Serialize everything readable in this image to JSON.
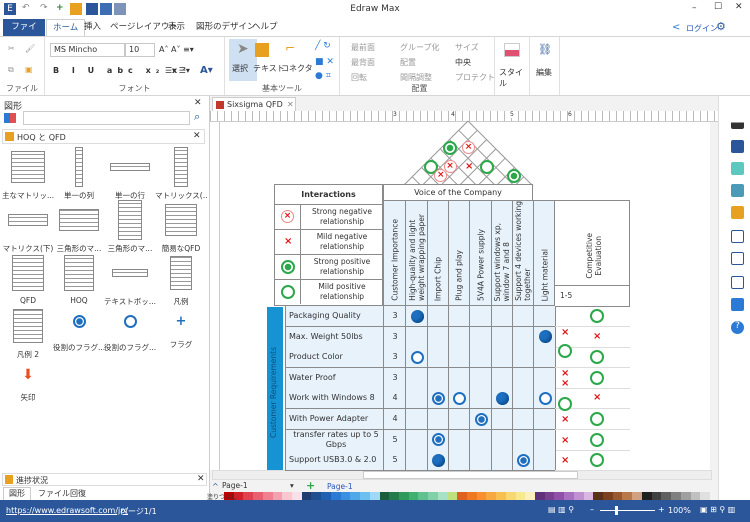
{
  "app": {
    "title": "Edraw Max",
    "login": "ログイン"
  },
  "tabs": [
    "ファイル",
    "ホーム",
    "挿入",
    "ページレイアウト",
    "表示",
    "図形のデザイン",
    "ヘルプ"
  ],
  "ribbon": {
    "font_name": "MS Mincho",
    "font_size": "10",
    "groups": {
      "file": "ファイル",
      "font": "フォント",
      "basic": "基本ツール",
      "arrange": "配置"
    },
    "tools": {
      "select": "選択",
      "text": "テキスト",
      "connector": "コネクタ"
    },
    "arrange_items": [
      "最前面",
      "グループ化",
      "サイズ",
      "最背面",
      "配置",
      "中央",
      "回転",
      "間隔調整",
      "プロテクト"
    ],
    "style": "スタイル",
    "edit": "編集"
  },
  "left": {
    "title": "図形",
    "library": "HOQ と QFD",
    "shapes": [
      "主なマトリッ...",
      "単一の列",
      "単一の行",
      "マトリックス(...",
      "マトリクス(下)",
      "三角形のマ...",
      "三角形のマ...",
      "簡易なQFD",
      "QFD",
      "HOQ",
      "テキストボッ...",
      "凡例",
      "凡例 2",
      "役割のフラグ...",
      "役割のフラグ...",
      "フラグ",
      "矢印"
    ],
    "bottom_title": "進捗状況",
    "bottom_tabs": [
      "図形",
      "ファイル回復"
    ]
  },
  "doc_tab": "Sixsigma QFD",
  "matrix": {
    "interactions_title": "Interactions",
    "legend": [
      "Strong negative relationship",
      "Mild negative relationship",
      "Strong positive relationship",
      "Mild positive relationship"
    ],
    "voice_title": "Voice of the Company",
    "columns": [
      "Customer Importance",
      "High-quality and light\nweight wrapping paper",
      "Import Chip",
      "Plug and play",
      "5V4A Power supply",
      "Support windows xp,\nwindow 7 and 8",
      "Support 4 devices working\ntogether",
      "Light material"
    ],
    "competitive": "Competitive\nEvaluation",
    "scale": "1-5",
    "side_label": "Customer Requirements",
    "rows": [
      {
        "label": "Packaging Quality",
        "importance": "3",
        "cells": {
          "1": "filled"
        },
        "comp": {
          "left": [],
          "right": "circle"
        }
      },
      {
        "label": "Max. Weight 50lbs",
        "importance": "3",
        "cells": {
          "7": "filled"
        },
        "comp": {
          "left": [
            "x"
          ],
          "right": "x"
        }
      },
      {
        "label": "Product Color",
        "importance": "3",
        "cells": {
          "1": "hollow"
        },
        "comp": {
          "left": [
            "circle"
          ],
          "right": "circle"
        }
      },
      {
        "label": "Water Proof",
        "importance": "3",
        "cells": {},
        "comp": {
          "left": [
            "x",
            "x"
          ],
          "right": "circle"
        }
      },
      {
        "label": "Work with Windows 8",
        "importance": "4",
        "cells": {
          "2": "target",
          "3": "hollow",
          "5": "filled",
          "7": "hollow"
        },
        "comp": {
          "left": [
            "circle"
          ],
          "right": "x"
        }
      },
      {
        "label": "  With Power Adapter",
        "importance": "4",
        "cells": {
          "4": "target"
        },
        "comp": {
          "left": [
            "x"
          ],
          "right": "circle"
        }
      },
      {
        "label": "transfer rates up to 5 Gbps",
        "importance": "5",
        "cells": {
          "2": "target"
        },
        "comp": {
          "left": [
            "x"
          ],
          "right": "circle"
        }
      },
      {
        "label": "Support USB3.0 & 2.0",
        "importance": "5",
        "cells": {
          "2": "filled",
          "6": "target"
        },
        "comp": {
          "left": [
            "x"
          ],
          "right": "circle"
        }
      }
    ],
    "roof": [
      {
        "type": "strong-positive",
        "col": 1,
        "row": 1
      },
      {
        "type": "strong-negative",
        "col": 2,
        "row": 1
      },
      {
        "type": "mild-positive",
        "col": 0,
        "row": 2
      },
      {
        "type": "strong-negative",
        "col": 1,
        "row": 2
      },
      {
        "type": "mild-negative",
        "col": 2,
        "row": 2
      },
      {
        "type": "mild-positive",
        "col": 3,
        "row": 2
      },
      {
        "type": "strong-negative",
        "col": 0.5,
        "row": 2.5
      },
      {
        "type": "strong-positive",
        "col": 4.5,
        "row": 2.5
      }
    ]
  },
  "pages": {
    "selector": "Page-1",
    "tab": "Page-1"
  },
  "status": {
    "url": "https://www.edrawsoft.com/jp/",
    "page": "ページ1/1",
    "zoom": "100%"
  },
  "ruler": [
    "3",
    "4",
    "5",
    "6"
  ],
  "colors": {
    "accent": "#2b579a",
    "blue_mark": "#1f6fc0",
    "green": "#2aa84a",
    "red": "#e01010"
  }
}
